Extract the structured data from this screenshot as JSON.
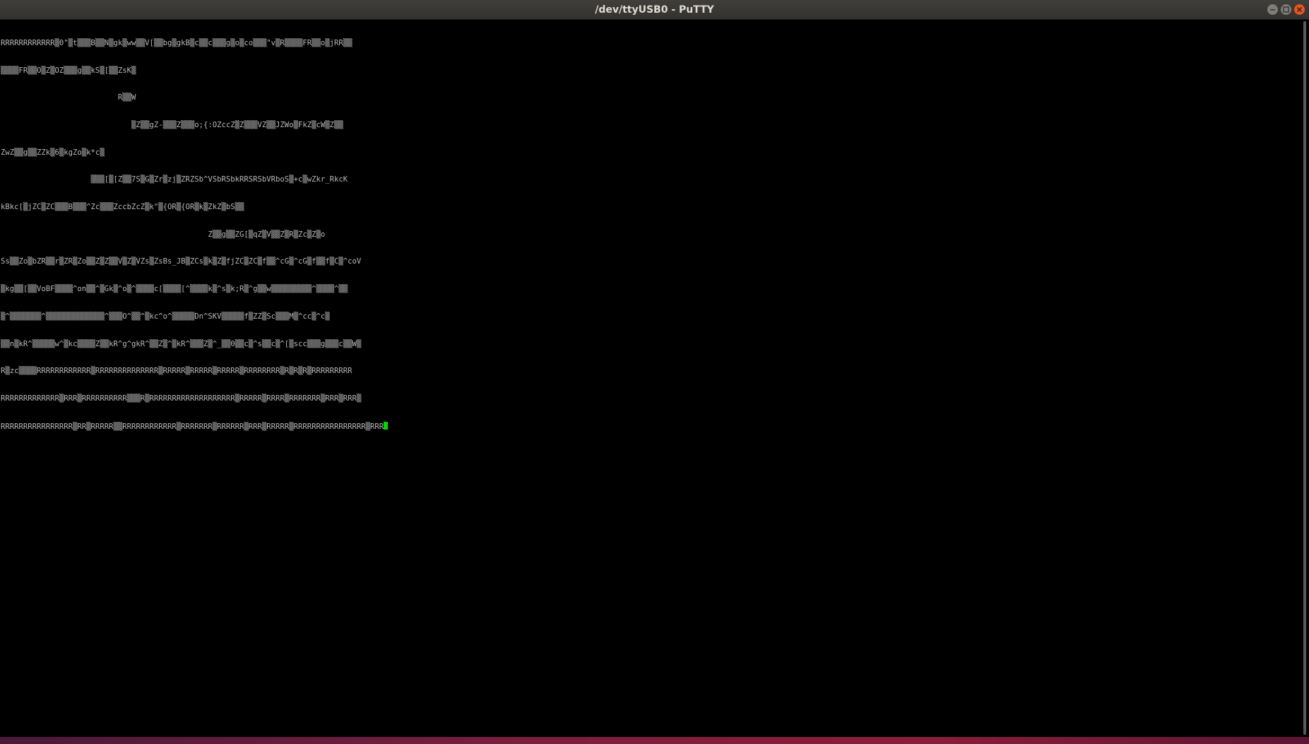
{
  "window": {
    "title": "/dev/ttyUSB0 - PuTTY",
    "controls": [
      "minimize",
      "maximize",
      "close"
    ]
  },
  "terminal": {
    "lines": [
      "RRRRRRRRRRRR▒0\"▒t▒▒▒B▒▒N▒gk▒ww▒▒V[▒▒bg▒gkB▒c▒▒c▒▒▒g▒o▒co▒▒▒\"v▒R▒▒▒▒FR▒▒o▒jRR▒▒",
      "▒▒▒▒FR▒▒O▒Z▒OZ▒▒▒g▒▒kS▒[▒▒ZsK▒",
      "                          R▒▒W",
      "                             ▒Z▒▒gZ-▒▒▒Z▒▒▒o;{:OZccZ▒Z▒▒▒VZ▒▒JZWo▒FkZ▒cW▒Z▒▒",
      "ZwZ▒▒g▒▒ZZk▒6▒kgZo▒k*c▒",
      "                    ▒▒▒[▒[Z▒▒7S▒G▒Zr▒zj▒ZRZSb^VSbRSbkRRSRSbVRboS▒+c▒wZkr_RkcK",
      "kBkc[▒jZC▒ZC▒▒▒B▒▒▒^Zc▒▒▒ZccbZcZ▒k\"▒{OR▒{OR▒k▒ZkZ▒bS▒▒",
      "                                              Z▒▒g▒▒ZG[▒qZ▒V▒▒Z▒R▒Zc▒Z▒o",
      "Ss▒▒Zo▒bZR▒▒r▒ZR▒Zo▒▒Z▒Z▒▒V▒Z▒VZs▒ZsBs_JB▒ZCs▒k▒Z▒fjZC▒ZC▒f▒▒^cG▒^cG▒f▒▒f▒C▒^coV",
      "▒kg▒▒[▒▒VoBF▒▒▒▒^on▒▒^▒Gk▒^o▒^▒▒▒▒c[▒▒▒▒[^▒▒▒▒k▒^s▒k;R▒^g▒▒w▒▒▒▒▒▒▒▒▒^▒▒▒▒^▒▒",
      "▒^▒▒▒▒▒▒▒^▒▒▒▒▒▒▒▒▒▒▒▒▒^▒▒▒O^▒▒^▒kc^o^▒▒▒▒▒Dn^SKV▒▒▒▒▒f▒ZZ▒Sc▒▒▒M▒^cc▒^c▒",
      "▒▒n▒kR^▒▒▒▒▒w^▒kc▒▒▒▒Z▒▒kR^g^gkR^▒▒Z▒^▒kR^▒▒▒Z▒^_▒▒0▒▒c▒^s▒▒c▒^[▒scc▒▒▒g▒▒▒c▒▒W▒",
      "R▒zc▒▒▒▒RRRRRRRRRRRR▒RRRRRRRRRRRRRR▒RRRRR▒RRRRR▒RRRRR▒RRRRRRRR▒R▒R▒R▒RRRRRRRRR",
      "RRRRRRRRRRRRR▒RRR▒RRRRRRRRRR▒▒▒R▒RRRRRRRRRRRRRRRRRRR▒RRRRR▒RRRR▒RRRRRRR▒RRR▒RRR▒",
      "RRRRRRRRRRRRRRRR▒RR▒RRRRR▒▒RRRRRRRRRRRR▒RRRRRRR▒RRRRRR▒RRR▒RRRRR▒RRRRRRRRRRRRRRRR▒RRR"
    ]
  },
  "colors": {
    "terminal_bg": "#000000",
    "terminal_fg": "#b8b8b8",
    "cursor": "#00d800",
    "titlebar": "#3a3936",
    "close_button": "#e9541e"
  },
  "icons": {
    "minimize": "minimize-icon",
    "maximize": "maximize-icon",
    "close": "close-icon"
  }
}
